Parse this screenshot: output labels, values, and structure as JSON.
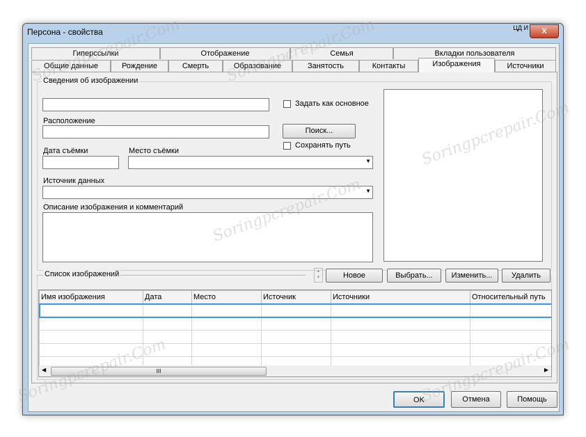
{
  "window": {
    "title": "Персона - свойства",
    "lang_indicator": "ЦД И",
    "close": "X"
  },
  "tabs_row1": [
    "Гиперссылки",
    "Отображение",
    "Семья",
    "Вкладки пользователя"
  ],
  "tabs_row2": [
    "Общие данные",
    "Рождение",
    "Смерть",
    "Образование",
    "Занятость",
    "Контакты",
    "Изображения",
    "Источники"
  ],
  "selected_tab": "Изображения",
  "image_info": {
    "group_label": "Сведения об изображении",
    "name_value": "",
    "set_primary_label": "Задать как основное",
    "set_primary_checked": false,
    "location_label": "Расположение",
    "location_value": "",
    "search_button": "Поиск...",
    "save_path_label": "Сохранять путь",
    "save_path_checked": false,
    "date_label": "Дата съёмки",
    "date_value": "",
    "place_label": "Место съёмки",
    "place_value": "",
    "source_label": "Источник данных",
    "source_value": "",
    "description_label": "Описание изображения и комментарий",
    "description_value": ""
  },
  "image_list": {
    "label": "Список изображений",
    "buttons": [
      "Новое",
      "Выбрать...",
      "Изменить...",
      "Удалить"
    ],
    "columns": [
      "Имя изображения",
      "Дата",
      "Место",
      "Источник",
      "Источники",
      "Относительный путь"
    ],
    "scroll_thumb": "III"
  },
  "footer": {
    "ok": "OK",
    "cancel": "Отмена",
    "help": "Помощь"
  },
  "watermark": "Soringpcrepair.Com"
}
